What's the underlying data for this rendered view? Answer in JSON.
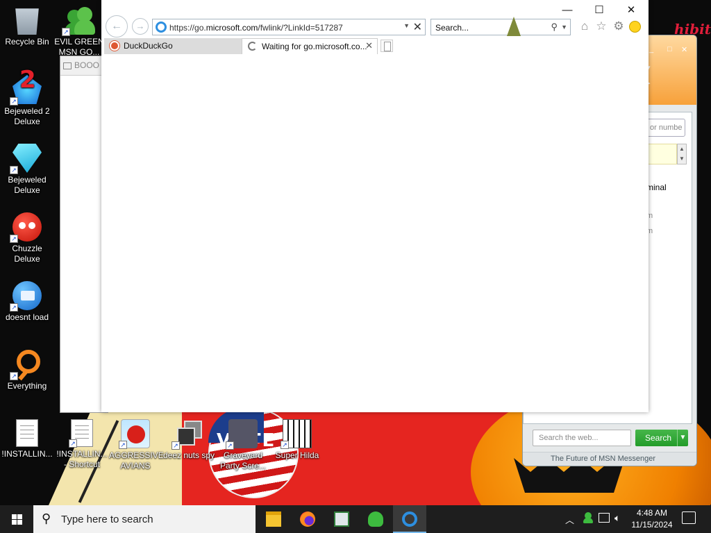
{
  "desktop": {
    "icons": [
      {
        "label": "Recycle Bin"
      },
      {
        "label": "EVIL GREEN MSN GO..."
      },
      {
        "label": "Bejeweled 2 Deluxe"
      },
      {
        "label": "Bejeweled Deluxe"
      },
      {
        "label": "Chuzzle Deluxe"
      },
      {
        "label": "doesnt load"
      },
      {
        "label": "Everything"
      },
      {
        "label": "!INSTALLIN..."
      },
      {
        "label": "!INSTALLIN... - Shortcut"
      },
      {
        "label": "AGGRESSIVE AVIANS"
      },
      {
        "label": "deez nuts spy"
      },
      {
        "label": "Graveyard Party Scre..."
      },
      {
        "label": "Super Hilda"
      }
    ],
    "wallpaper_text": {
      "sign": "VOTE",
      "corner": "hibit"
    }
  },
  "background_window": {
    "title": "BOOO"
  },
  "msn_window": {
    "number_field_placeholder": "or numbe",
    "visible_text": "minal",
    "search_placeholder": "Search the web...",
    "search_button": "Search",
    "footer": "The Future of MSN Messenger"
  },
  "browser": {
    "url_prefix": "https://go.",
    "url_domain": "microsoft.com",
    "url_path": "/fwlink/?LinkId=517287",
    "search_placeholder": "Search...",
    "tabs": [
      {
        "label": "DuckDuckGo",
        "active": false
      },
      {
        "label": "Waiting for go.microsoft.co...",
        "active": true
      }
    ]
  },
  "taskbar": {
    "search_placeholder": "Type here to search",
    "time": "4:48 AM",
    "date": "11/15/2024",
    "pinned": [
      "file-explorer",
      "firefox",
      "msn-messenger-window",
      "msn-messenger",
      "internet-explorer"
    ]
  }
}
